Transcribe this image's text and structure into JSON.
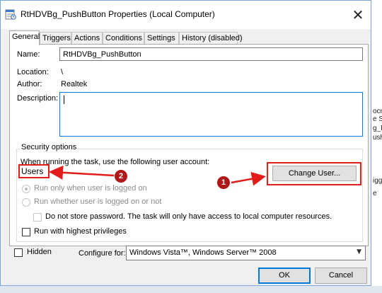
{
  "window": {
    "title": "RtHDVBg_PushButton Properties (Local Computer)",
    "close_glyph": "✕"
  },
  "tabs": [
    "General",
    "Triggers",
    "Actions",
    "Conditions",
    "Settings",
    "History (disabled)"
  ],
  "general": {
    "name_label": "Name:",
    "name_value": "RtHDVBg_PushButton",
    "location_label": "Location:",
    "location_value": "\\",
    "author_label": "Author:",
    "author_value": "Realtek",
    "description_label": "Description:",
    "description_value": ""
  },
  "security": {
    "group_title": "Security options",
    "account_prompt": "When running the task, use the following user account:",
    "account_value": "Users",
    "change_user_label": "Change User...",
    "radio_logged_on": "Run only when user is logged on",
    "radio_logged_on_or_not": "Run whether user is logged on or not",
    "no_store_password": "Do not store password.  The task will only have access to local computer resources.",
    "highest_privileges": "Run with highest privileges"
  },
  "footer": {
    "hidden_label": "Hidden",
    "configure_label": "Configure for:",
    "configure_value": "Windows Vista™, Windows Server™ 2008",
    "ok_label": "OK",
    "cancel_label": "Cancel"
  },
  "annotations": {
    "badge_1": "1",
    "badge_2": "2",
    "highlight_color": "#e21b1b",
    "badge_color": "#b01818"
  },
  "background_fragments": [
    "ocr",
    "e St",
    "g_P",
    "ush",
    "igg",
    "e"
  ]
}
